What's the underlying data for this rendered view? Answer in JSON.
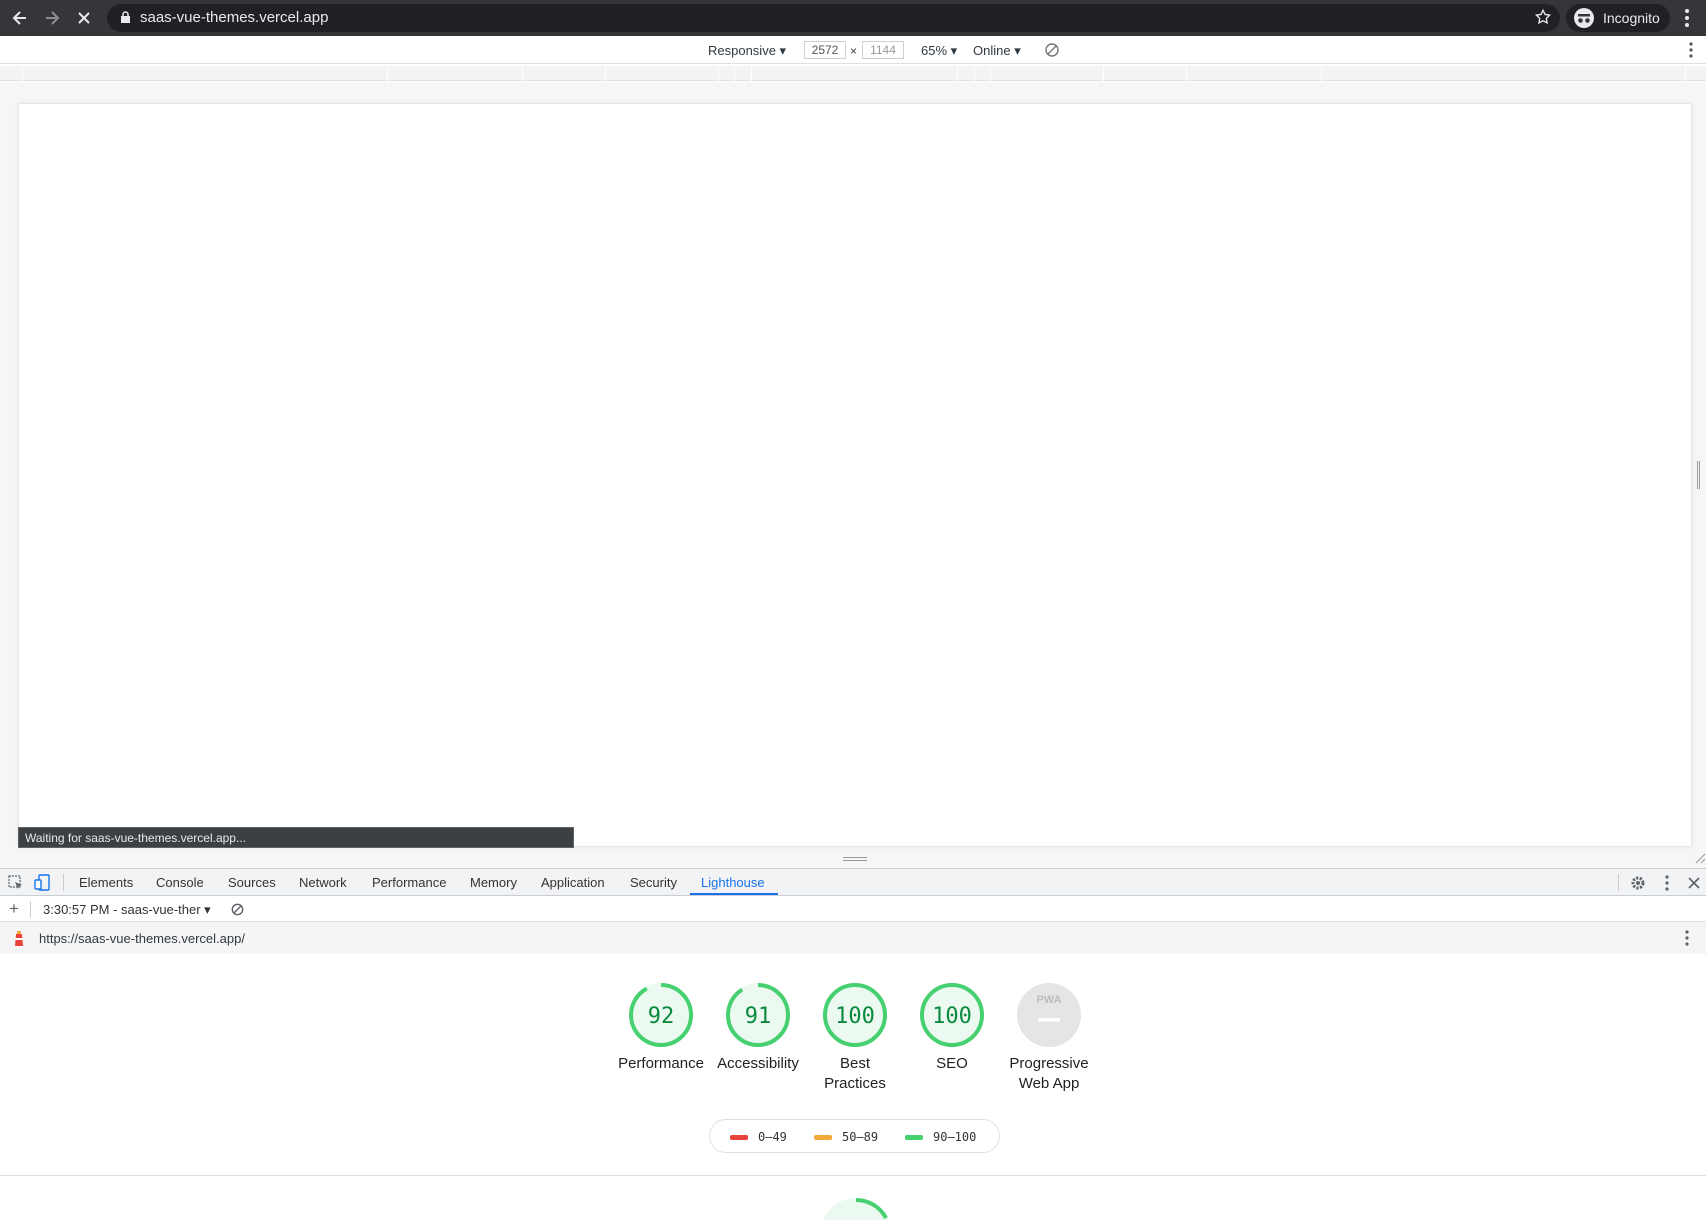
{
  "browser": {
    "url_display": "saas-vue-themes.vercel.app",
    "profile_label": "Incognito"
  },
  "device_toolbar": {
    "mode": "Responsive",
    "width": "2572",
    "height": "1144",
    "zoom": "65%",
    "throttling": "Online"
  },
  "status_bubble": "Waiting for saas-vue-themes.vercel.app...",
  "devtools": {
    "tabs": [
      "Elements",
      "Console",
      "Sources",
      "Network",
      "Performance",
      "Memory",
      "Application",
      "Security",
      "Lighthouse"
    ],
    "active_tab": "Lighthouse",
    "report_selector": "3:30:57 PM - saas-vue-ther",
    "report_url": "https://saas-vue-themes.vercel.app/"
  },
  "lighthouse": {
    "scores": [
      {
        "label": "Performance",
        "score": 92
      },
      {
        "label": "Accessibility",
        "score": 91
      },
      {
        "label": "Best Practices",
        "score": 100
      },
      {
        "label": "SEO",
        "score": 100
      },
      {
        "label": "Progressive Web App",
        "score": null,
        "badge": "PWA"
      }
    ],
    "legend": [
      {
        "range": "0–49",
        "color": "#e8433a"
      },
      {
        "range": "50–89",
        "color": "#f4a83a"
      },
      {
        "range": "90–100",
        "color": "#46d06f"
      }
    ],
    "pass_color": "#46d06f",
    "track_color": "#e6f8ec"
  }
}
